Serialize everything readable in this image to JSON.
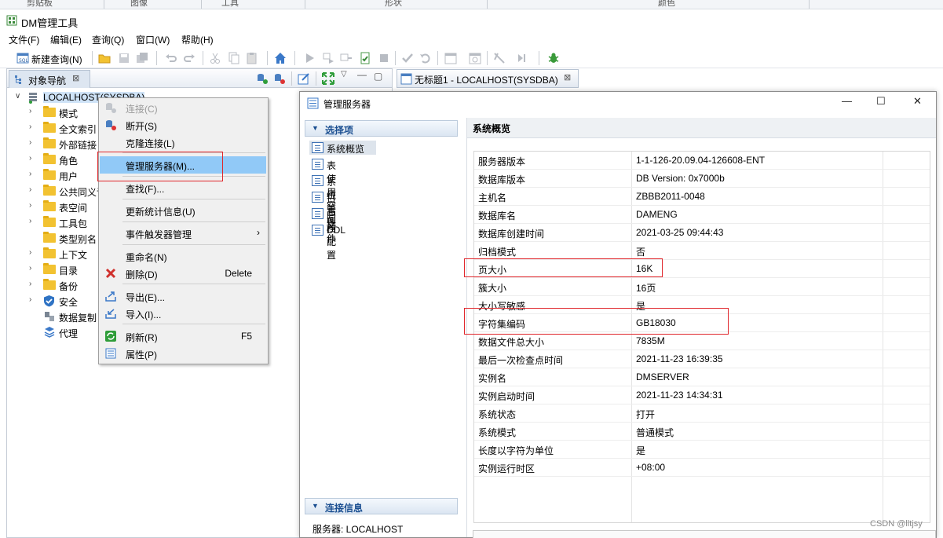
{
  "top_strip": {
    "items": [
      "剪贴板",
      "图像",
      "工具",
      "形状",
      "颜色"
    ]
  },
  "app": {
    "title": "DM管理工具"
  },
  "menu": {
    "items": [
      "文件(F)",
      "编辑(E)",
      "查询(Q)",
      "窗口(W)",
      "帮助(H)"
    ]
  },
  "toolbar": {
    "new_query_label": "新建查询(N)"
  },
  "left_panel": {
    "tab_label": "对象导航",
    "tab_close": "⊠",
    "root_label": "LOCALHOST(SYSDBA)",
    "tree": [
      {
        "label": "模式",
        "icon": "folder-icon"
      },
      {
        "label": "全文索引",
        "icon": "folder-icon"
      },
      {
        "label": "外部链接",
        "icon": "folder-icon"
      },
      {
        "label": "角色",
        "icon": "folder-icon"
      },
      {
        "label": "用户",
        "icon": "folder-icon"
      },
      {
        "label": "公共同义词",
        "icon": "folder-icon"
      },
      {
        "label": "表空间",
        "icon": "folder-icon"
      },
      {
        "label": "工具包",
        "icon": "folder-icon"
      },
      {
        "label": "类型别名",
        "icon": "folder-icon"
      },
      {
        "label": "上下文",
        "icon": "folder-icon"
      },
      {
        "label": "目录",
        "icon": "folder-icon"
      },
      {
        "label": "备份",
        "icon": "folder-icon"
      },
      {
        "label": "安全",
        "icon": "shield-icon"
      },
      {
        "label": "数据复制",
        "icon": "replication-icon"
      },
      {
        "label": "代理",
        "icon": "agent-icon"
      }
    ]
  },
  "context_menu": {
    "items": [
      {
        "label": "连接(C)",
        "accel": "",
        "disabled": true
      },
      {
        "label": "断开(S)",
        "accel": ""
      },
      {
        "label": "克隆连接(L)",
        "accel": ""
      },
      {
        "label": "管理服务器(M)...",
        "accel": "",
        "highlighted": true
      },
      {
        "label": "查找(F)...",
        "accel": ""
      },
      {
        "label": "更新统计信息(U)",
        "accel": ""
      },
      {
        "label": "事件触发器管理",
        "accel": "",
        "submenu": "›"
      },
      {
        "label": "重命名(N)",
        "accel": ""
      },
      {
        "label": "删除(D)",
        "accel": "Delete"
      },
      {
        "label": "导出(E)...",
        "accel": ""
      },
      {
        "label": "导入(I)...",
        "accel": ""
      },
      {
        "label": "刷新(R)",
        "accel": "F5"
      },
      {
        "label": "属性(P)",
        "accel": ""
      }
    ]
  },
  "editor_tab": {
    "label": "无标题1 - LOCALHOST(SYSDBA)",
    "close": "⊠"
  },
  "dialog": {
    "title": "管理服务器",
    "controls": {
      "minimize": "—",
      "maximize": "☐",
      "close": "✕"
    },
    "select_header": "选择项",
    "nav": [
      "系统概览",
      "表使用空间",
      "系统管理",
      "日志文件",
      "归档配置",
      "DDL"
    ],
    "conn_header": "连接信息",
    "conn_info": "服务器: LOCALHOST",
    "section_title": "系统概览",
    "rows": [
      {
        "k": "服务器版本",
        "v": "1-1-126-20.09.04-126608-ENT"
      },
      {
        "k": "数据库版本",
        "v": "DB Version: 0x7000b"
      },
      {
        "k": "主机名",
        "v": "ZBBB2011-0048"
      },
      {
        "k": "数据库名",
        "v": "DAMENG"
      },
      {
        "k": "数据库创建时间",
        "v": "2021-03-25 09:44:43"
      },
      {
        "k": "归档模式",
        "v": "否"
      },
      {
        "k": "页大小",
        "v": "16K"
      },
      {
        "k": "簇大小",
        "v": "16页"
      },
      {
        "k": "大小写敏感",
        "v": "是"
      },
      {
        "k": "字符集编码",
        "v": "GB18030"
      },
      {
        "k": "数据文件总大小",
        "v": "7835M"
      },
      {
        "k": "最后一次检查点时间",
        "v": "2021-11-23 16:39:35"
      },
      {
        "k": "实例名",
        "v": "DMSERVER"
      },
      {
        "k": "实例启动时间",
        "v": "2021-11-23 14:34:31"
      },
      {
        "k": "系统状态",
        "v": "打开"
      },
      {
        "k": "系统模式",
        "v": "普通模式"
      },
      {
        "k": "长度以字符为单位",
        "v": "是"
      },
      {
        "k": "实例运行时区",
        "v": "+08:00"
      }
    ]
  },
  "watermark": "CSDN @lltjsy",
  "colors": {
    "highlight": "#91c9f7",
    "annotation_red": "#e0262b",
    "header_blue": "#1b4f91"
  }
}
